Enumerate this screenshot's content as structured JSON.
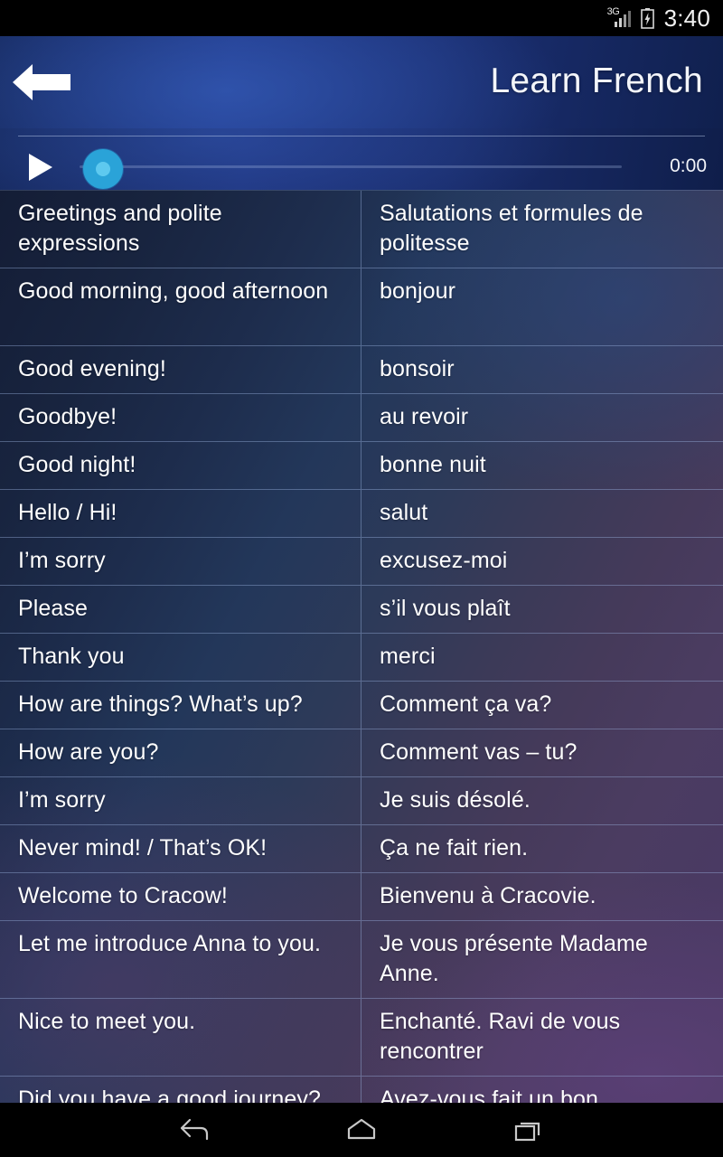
{
  "statusbar": {
    "network": "3G",
    "network_icon": "signal-bars-icon",
    "battery_icon": "battery-charging-icon",
    "time": "3:40"
  },
  "header": {
    "back_icon": "back-arrow-icon",
    "title": "Learn French"
  },
  "player": {
    "play_icon": "play-icon",
    "seek_thumb": "seekbar-thumb",
    "elapsed_time": "0:00",
    "progress_percent": 0
  },
  "table": {
    "rows": [
      {
        "en": "Greetings and polite expressions",
        "fr": "Salutations et formules de politesse",
        "lines": 2
      },
      {
        "en": "Good morning, good afternoon",
        "fr": "bonjour",
        "lines": 2
      },
      {
        "en": "Good evening!",
        "fr": "bonsoir",
        "lines": 1
      },
      {
        "en": "Goodbye!",
        "fr": "au revoir",
        "lines": 1
      },
      {
        "en": "Good night!",
        "fr": "bonne nuit",
        "lines": 1
      },
      {
        "en": "Hello / Hi!",
        "fr": "salut",
        "lines": 1
      },
      {
        "en": "I’m sorry",
        "fr": "excusez-moi",
        "lines": 1
      },
      {
        "en": "Please",
        "fr": "s’il vous plaît",
        "lines": 1
      },
      {
        "en": "Thank you",
        "fr": "merci",
        "lines": 1
      },
      {
        "en": "How are things? What’s up?",
        "fr": "Comment ça va?",
        "lines": 1
      },
      {
        "en": "How are you?",
        "fr": "Comment vas – tu?",
        "lines": 1
      },
      {
        "en": "I’m sorry",
        "fr": "Je suis désolé.",
        "lines": 1
      },
      {
        "en": "Never mind! / That’s OK!",
        "fr": "Ça ne fait rien.",
        "lines": 1
      },
      {
        "en": "Welcome to Cracow!",
        "fr": "Bienvenu à Cracovie.",
        "lines": 1
      },
      {
        "en": "Let me introduce Anna to you.",
        "fr": "Je vous présente Madame Anne.",
        "lines": 2
      },
      {
        "en": "Nice to meet you.",
        "fr": "Enchanté. Ravi de vous rencontrer",
        "lines": 2
      },
      {
        "en": "Did you have a good journey?",
        "fr": "Avez-vous fait un bon",
        "lines": 1
      }
    ]
  },
  "navbar": {
    "back_icon": "nav-back-icon",
    "home_icon": "nav-home-icon",
    "recents_icon": "nav-recents-icon"
  },
  "colors": {
    "header_blue": "#1f3686",
    "accent_cyan": "#2aa3d8",
    "table_top": "#141d36",
    "table_bottom": "#4b3a63",
    "text_white": "#ffffff"
  }
}
